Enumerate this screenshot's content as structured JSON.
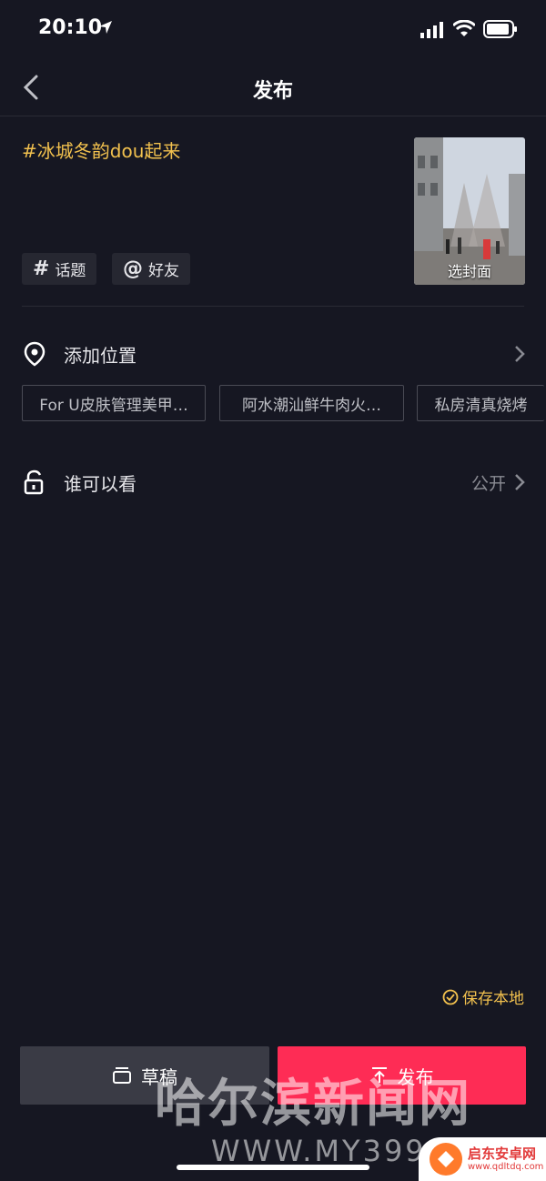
{
  "status_bar": {
    "time": "20:10"
  },
  "nav": {
    "title": "发布"
  },
  "post": {
    "caption": "#冰城冬韵dou起来",
    "topic_button": "话题",
    "friend_button": "好友",
    "cover_label": "选封面"
  },
  "location": {
    "label": "添加位置",
    "suggestions": [
      "For U皮肤管理美甲…",
      "阿水潮汕鲜牛肉火…",
      "私房清真烧烤"
    ]
  },
  "visibility": {
    "label": "谁可以看",
    "value": "公开"
  },
  "save_local": "保存本地",
  "actions": {
    "draft": "草稿",
    "publish": "发布"
  },
  "watermark": {
    "text": "哈尔滨新闻网",
    "url": "WWW.MY399.CO"
  },
  "site_logo": {
    "name": "启东安卓网",
    "url": "www.qdltdq.com"
  },
  "colors": {
    "background": "#161722",
    "accent_yellow": "#f2c14e",
    "publish_red": "#fe2c55"
  }
}
